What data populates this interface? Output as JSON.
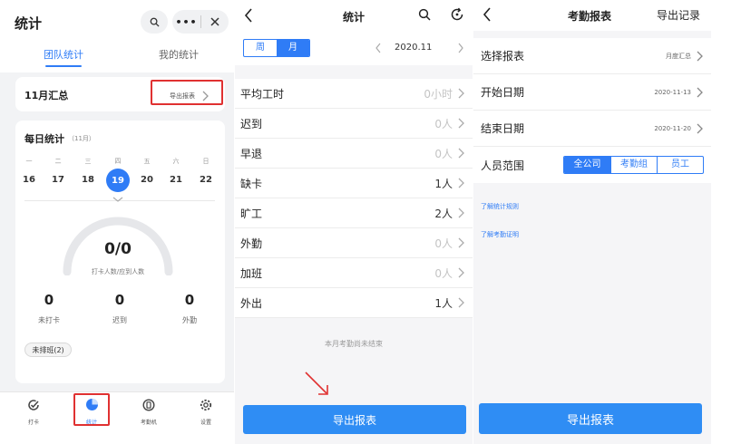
{
  "panel1": {
    "title": "统计",
    "tabs": [
      "团队统计",
      "我的统计"
    ],
    "summary": {
      "title": "11月汇总",
      "export_label": "导出报表"
    },
    "daily": {
      "title": "每日统计",
      "month": "（11月）",
      "weekdays": [
        "一",
        "二",
        "三",
        "四",
        "五",
        "六",
        "日"
      ],
      "days": [
        "16",
        "17",
        "18",
        "19",
        "20",
        "21",
        "22"
      ],
      "selected_day": "19"
    },
    "gauge": {
      "value": "0/0",
      "label": "打卡人数/应到人数",
      "progress": 0
    },
    "stats": [
      {
        "value": "0",
        "label": "未打卡"
      },
      {
        "value": "0",
        "label": "迟到"
      },
      {
        "value": "0",
        "label": "外勤"
      }
    ],
    "unscheduled_chip": "未排班(2)",
    "nav": [
      {
        "label": "打卡",
        "icon": "check-icon"
      },
      {
        "label": "统计",
        "icon": "pie-chart-icon"
      },
      {
        "label": "考勤机",
        "icon": "device-icon"
      },
      {
        "label": "设置",
        "icon": "gear-icon"
      }
    ]
  },
  "panel2": {
    "title": "统计",
    "period_tabs": [
      "周",
      "月"
    ],
    "active_period": "月",
    "month": "2020.11",
    "rows": [
      {
        "label": "平均工时",
        "value": "0小时",
        "muted": true
      },
      {
        "label": "迟到",
        "value": "0人",
        "muted": true
      },
      {
        "label": "早退",
        "value": "0人",
        "muted": true
      },
      {
        "label": "缺卡",
        "value": "1人",
        "muted": false
      },
      {
        "label": "旷工",
        "value": "2人",
        "muted": false
      },
      {
        "label": "外勤",
        "value": "0人",
        "muted": true
      },
      {
        "label": "加班",
        "value": "0人",
        "muted": true
      },
      {
        "label": "外出",
        "value": "1人",
        "muted": false
      }
    ],
    "notice": "本月考勤尚未结束",
    "export_button": "导出报表"
  },
  "panel3": {
    "title": "考勤报表",
    "export_records": "导出记录",
    "rows": [
      {
        "label": "选择报表",
        "value": "月度汇总"
      },
      {
        "label": "开始日期",
        "value": "2020-11-13"
      },
      {
        "label": "结束日期",
        "value": "2020-11-20"
      }
    ],
    "scope": {
      "label": "人员范围",
      "options": [
        "全公司",
        "考勤组",
        "员工"
      ],
      "selected": "全公司"
    },
    "links": [
      "了解统计规则",
      "了解考勤证明"
    ],
    "export_button": "导出报表"
  },
  "colors": {
    "accent": "#2f7cf6",
    "highlight": "#e03131",
    "button": "#2f8df4"
  }
}
